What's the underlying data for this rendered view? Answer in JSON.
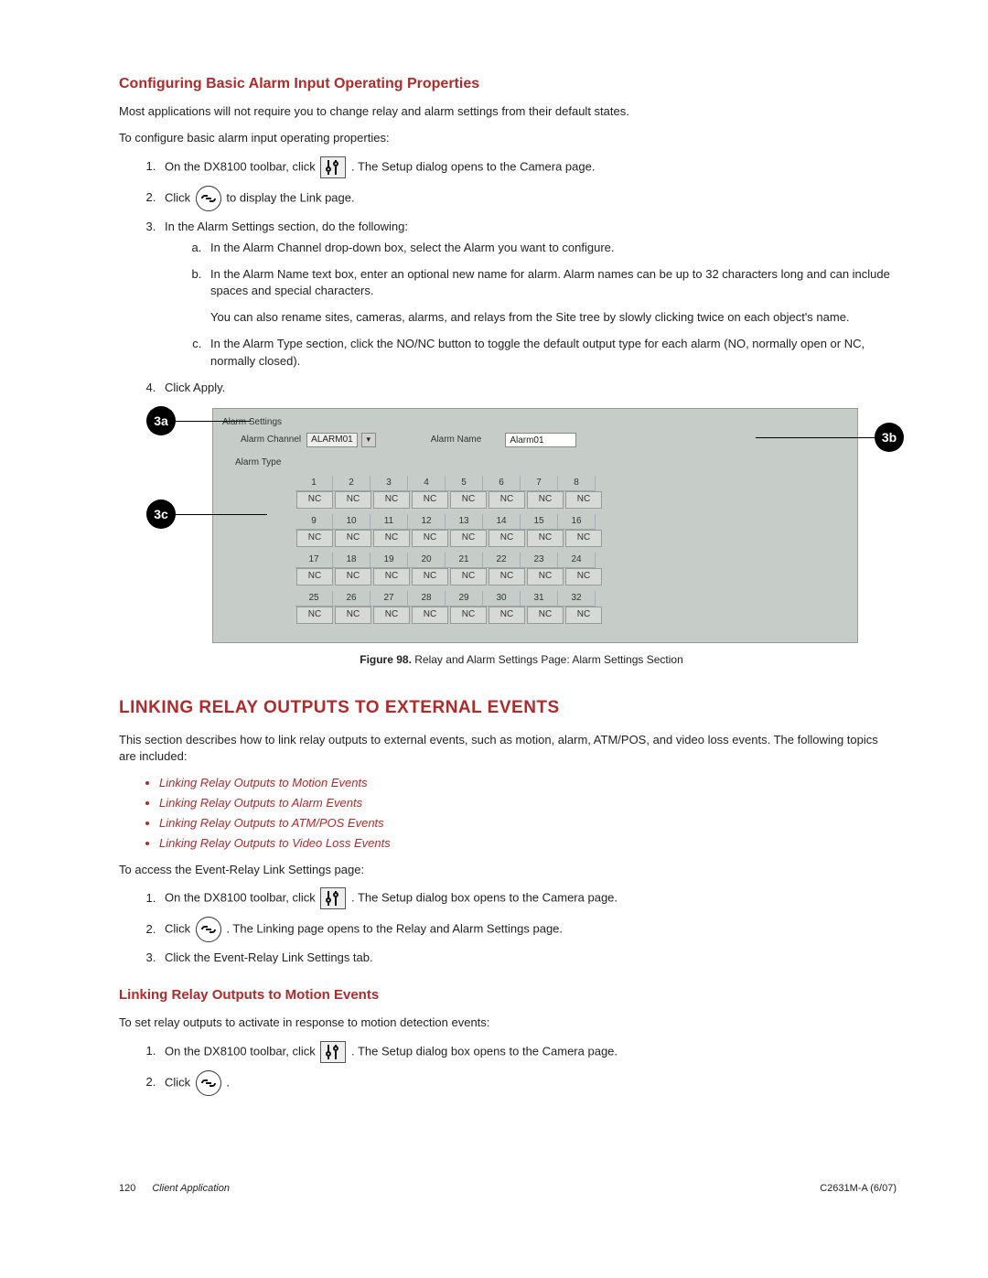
{
  "section1": {
    "title": "Configuring Basic Alarm Input Operating Properties",
    "p1": "Most applications will not require you to change relay and alarm settings from their default states.",
    "p2": "To configure basic alarm input operating properties:",
    "li1a": "On the DX8100 toolbar, click ",
    "li1b": ". The Setup dialog opens to the Camera page.",
    "li2a": "Click ",
    "li2b": " to display the Link page.",
    "li3": "In the Alarm Settings section, do the following:",
    "li3a": "In the Alarm Channel drop-down box, select the Alarm you want to configure.",
    "li3b": "In the Alarm Name text box, enter an optional new name for alarm. Alarm names can be up to 32 characters long and can include spaces and special characters.",
    "li3bnote": "You can also rename sites, cameras, alarms, and relays from the Site tree by slowly clicking twice on each object's name.",
    "li3c": "In the Alarm Type section, click the NO/NC button to toggle the default output type for each alarm (NO, normally open or NC, normally closed).",
    "li4": "Click Apply."
  },
  "figure": {
    "callout_a": "3a",
    "callout_b": "3b",
    "callout_c": "3c",
    "fs_label": "Alarm Settings",
    "ac_label": "Alarm Channel",
    "ac_value": "ALARM01",
    "an_label": "Alarm Name",
    "an_value": "Alarm01",
    "at_label": "Alarm Type",
    "nc": "NC",
    "nums": [
      "1",
      "2",
      "3",
      "4",
      "5",
      "6",
      "7",
      "8",
      "9",
      "10",
      "11",
      "12",
      "13",
      "14",
      "15",
      "16",
      "17",
      "18",
      "19",
      "20",
      "21",
      "22",
      "23",
      "24",
      "25",
      "26",
      "27",
      "28",
      "29",
      "30",
      "31",
      "32"
    ],
    "caption_b": "Figure 98.",
    "caption": "  Relay and Alarm Settings Page: Alarm Settings Section"
  },
  "section2": {
    "title": "LINKING RELAY OUTPUTS TO EXTERNAL EVENTS",
    "p1": "This section describes how to link relay outputs to external events, such as motion, alarm, ATM/POS, and video loss events. The following topics are included:",
    "links": [
      "Linking Relay Outputs to Motion Events",
      "Linking Relay Outputs to Alarm Events",
      "Linking Relay Outputs to ATM/POS Events",
      "Linking Relay Outputs to Video Loss Events"
    ],
    "p2": "To access the Event-Relay Link Settings page:",
    "li1a": "On the DX8100 toolbar, click ",
    "li1b": ". The Setup dialog box opens to the Camera page.",
    "li2a": "Click ",
    "li2b": ". The Linking page opens to the Relay and Alarm Settings page.",
    "li3": "Click the Event-Relay Link Settings tab."
  },
  "section3": {
    "title": "Linking Relay Outputs to Motion Events",
    "p1": "To set relay outputs to activate in response to motion detection events:",
    "li1a": "On the DX8100 toolbar, click ",
    "li1b": ". The Setup dialog box opens to the Camera page.",
    "li2a": "Click ",
    "li2b": " ."
  },
  "footer": {
    "page": "120",
    "doc": "Client Application",
    "right": "C2631M-A (6/07)"
  }
}
